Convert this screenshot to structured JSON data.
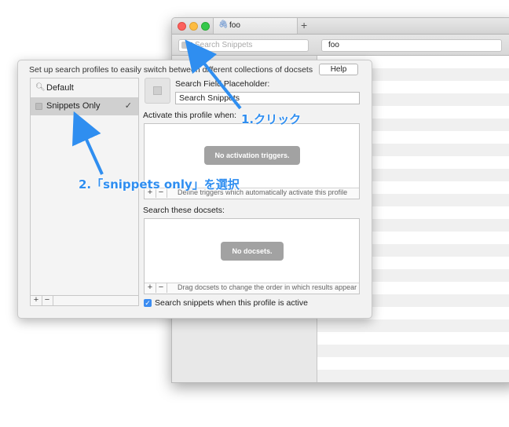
{
  "window": {
    "tab_title": "foo",
    "tab_add": "+",
    "search_left_placeholder": "Search Snippets",
    "search_right_value": "foo"
  },
  "popover": {
    "description": "Set up search profiles to easily switch between different collections of docsets",
    "help_label": "Help",
    "profiles": [
      {
        "label": "Default",
        "icon": "search-icon",
        "selected": false
      },
      {
        "label": "Snippets Only",
        "icon": "snippets-icon",
        "selected": true,
        "check": "✓"
      }
    ],
    "list_add": "+",
    "list_remove": "−",
    "placeholder_label": "Search Field Placeholder:",
    "placeholder_value": "Search Snippets",
    "activate_label": "Activate this profile when:",
    "no_triggers": "No activation triggers.",
    "triggers_hint": "Define triggers which automatically activate this profile",
    "docsets_label": "Search these docsets:",
    "no_docsets": "No docsets.",
    "docsets_hint": "Drag docsets to change the order in which results appear",
    "checkbox_label": "Search snippets when this profile is active",
    "checkbox_checked": true
  },
  "annotations": {
    "step1": "1.クリック",
    "step2": "2.「snippets only」を選択"
  },
  "colors": {
    "annotation": "#2f8ef0",
    "selection": "#d0d0d0",
    "checkbox": "#3b8cf1"
  }
}
